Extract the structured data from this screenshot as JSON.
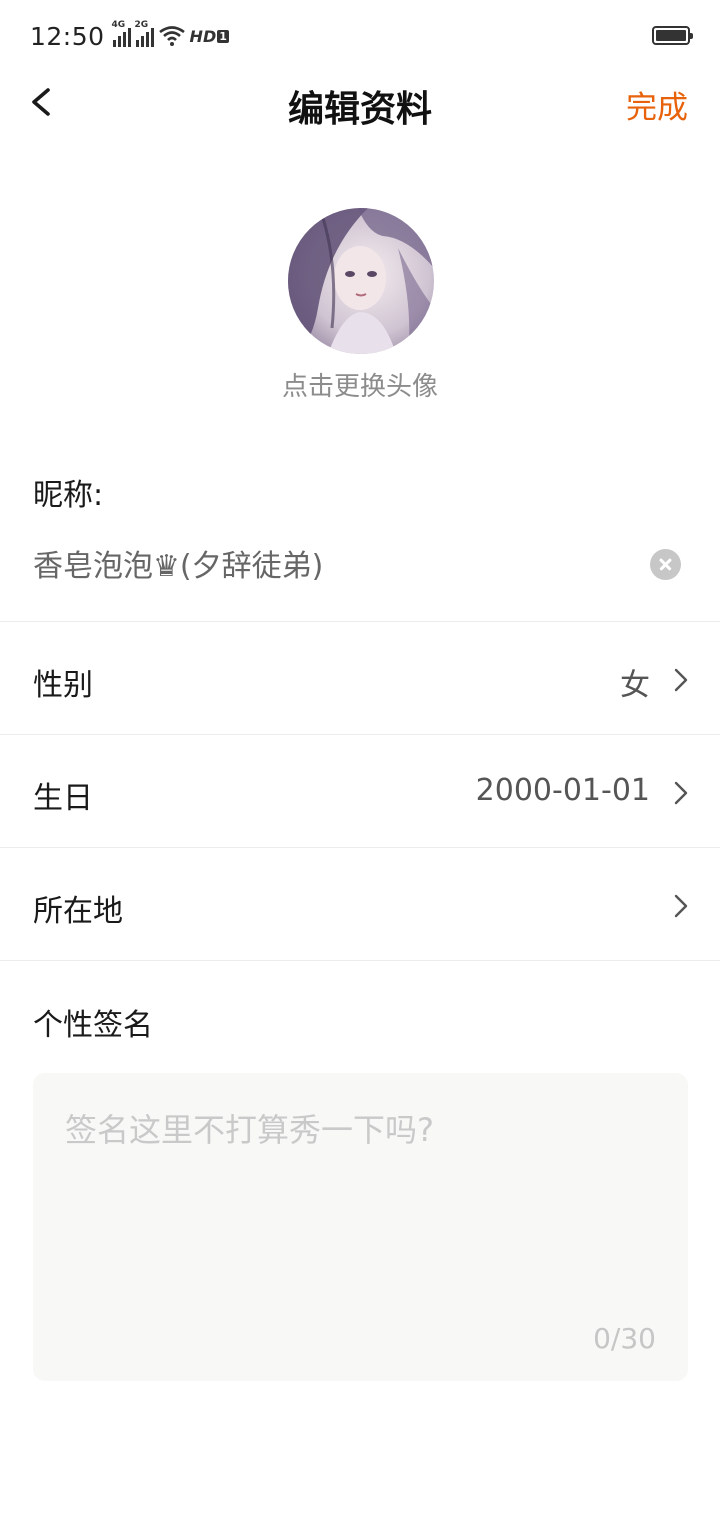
{
  "status_bar": {
    "time": "12:50",
    "network_1": "4G",
    "network_2": "2G",
    "hd_label": "HD",
    "hd_index": "1"
  },
  "nav": {
    "title": "编辑资料",
    "done_label": "完成",
    "done_color": "#e8620b"
  },
  "avatar": {
    "hint": "点击更换头像"
  },
  "nickname": {
    "label": "昵称:",
    "value": "香皂泡泡♛(夕辞徒弟)"
  },
  "rows": [
    {
      "label": "性别",
      "value": "女"
    },
    {
      "label": "生日",
      "value": "2000-01-01"
    },
    {
      "label": "所在地",
      "value": ""
    }
  ],
  "signature": {
    "label": "个性签名",
    "placeholder": "签名这里不打算秀一下吗?",
    "count": "0/30"
  },
  "icons": {
    "back": "chevron-left-icon",
    "clear": "clear-circle-icon",
    "row_arrow": "chevron-right-icon"
  }
}
